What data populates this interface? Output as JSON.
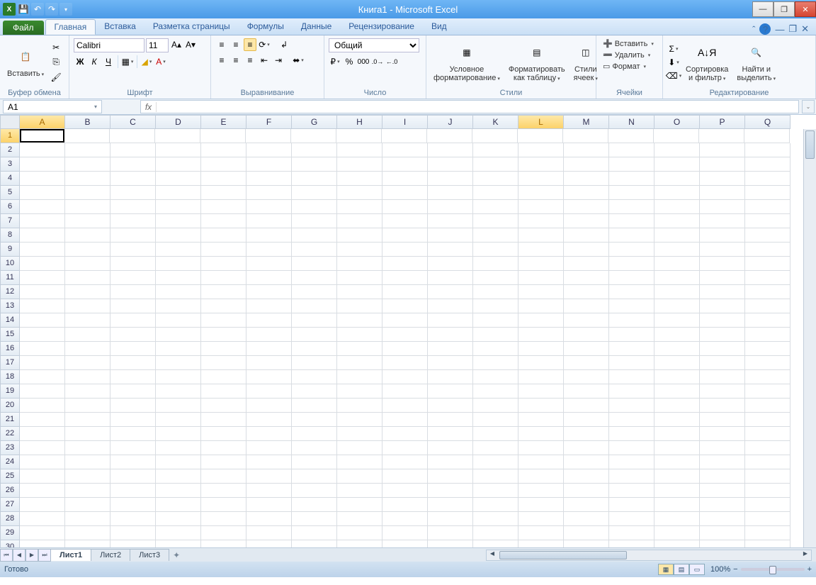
{
  "app": {
    "title": "Книга1 - Microsoft Excel"
  },
  "qat": {
    "save": "💾",
    "undo": "↶",
    "redo": "↷"
  },
  "tabs": {
    "file": "Файл",
    "items": [
      "Главная",
      "Вставка",
      "Разметка страницы",
      "Формулы",
      "Данные",
      "Рецензирование",
      "Вид"
    ],
    "active": "Главная"
  },
  "clipboard": {
    "paste": "Вставить",
    "label": "Буфер обмена"
  },
  "font": {
    "name": "Calibri",
    "size": "11",
    "bold": "Ж",
    "italic": "К",
    "underline": "Ч",
    "label": "Шрифт"
  },
  "align": {
    "label": "Выравнивание"
  },
  "number": {
    "format": "Общий",
    "label": "Число"
  },
  "styles": {
    "cond": "Условное\nформатирование",
    "table": "Форматировать\nкак таблицу",
    "cell": "Стили\nячеек",
    "label": "Стили"
  },
  "cells": {
    "insert": "Вставить",
    "delete": "Удалить",
    "format": "Формат",
    "label": "Ячейки"
  },
  "editing": {
    "sort": "Сортировка\nи фильтр",
    "find": "Найти и\nвыделить",
    "label": "Редактирование"
  },
  "formula": {
    "cellref": "A1"
  },
  "columns": [
    "A",
    "B",
    "C",
    "D",
    "E",
    "F",
    "G",
    "H",
    "I",
    "J",
    "K",
    "L",
    "M",
    "N",
    "O",
    "P",
    "Q"
  ],
  "rows": 30,
  "activeCell": {
    "row": 1,
    "col": "A"
  },
  "highlightCols": [
    "A",
    "L"
  ],
  "sheets": {
    "items": [
      "Лист1",
      "Лист2",
      "Лист3"
    ],
    "active": "Лист1"
  },
  "status": {
    "ready": "Готово",
    "zoom": "100%"
  }
}
